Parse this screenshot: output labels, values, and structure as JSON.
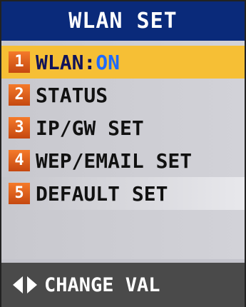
{
  "header": {
    "title": "WLAN SET"
  },
  "menu": {
    "items": [
      {
        "number": "1",
        "label": "WLAN:",
        "value": "ON"
      },
      {
        "number": "2",
        "label": "STATUS"
      },
      {
        "number": "3",
        "label": "IP/GW SET"
      },
      {
        "number": "4",
        "label": "WEP/EMAIL SET"
      },
      {
        "number": "5",
        "label": "DEFAULT SET"
      }
    ]
  },
  "footer": {
    "hint": "CHANGE VAL",
    "icons": [
      "left-arrow-icon",
      "right-arrow-icon"
    ]
  },
  "colors": {
    "title_bg": "#0a2a7a",
    "selected_bg": "#f6bf35",
    "number_badge": "#e0621e",
    "value_text": "#1f6bff",
    "footer_bg": "#4a4a4a"
  }
}
